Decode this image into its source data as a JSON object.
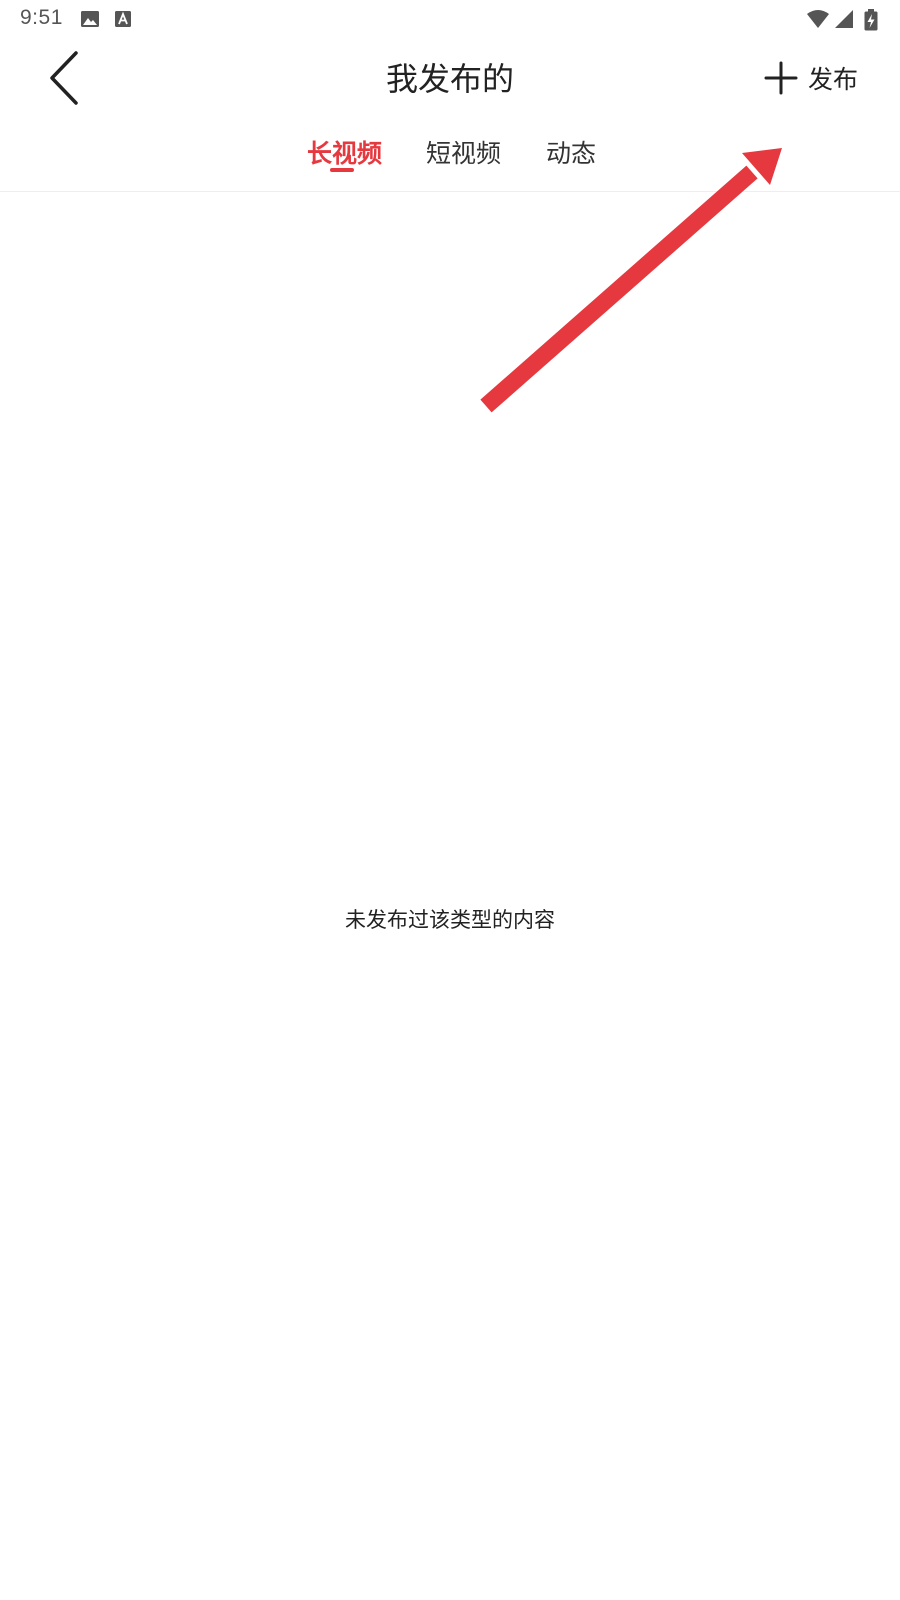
{
  "status_bar": {
    "time": "9:51",
    "icons": [
      "image-icon",
      "text-a-icon",
      "wifi-icon",
      "cell-signal-icon",
      "battery-charging-icon"
    ]
  },
  "header": {
    "title": "我发布的",
    "back_icon": "chevron-left-icon",
    "publish": {
      "icon": "plus-icon",
      "label": "发布"
    }
  },
  "tabs": [
    {
      "label": "长视频",
      "active": true
    },
    {
      "label": "短视频",
      "active": false
    },
    {
      "label": "动态",
      "active": false
    }
  ],
  "empty_state": {
    "message": "未发布过该类型的内容"
  },
  "colors": {
    "accent": "#e5383f",
    "text": "#222222",
    "status_icons": "#555555",
    "annotation_arrow": "#e5383f"
  }
}
